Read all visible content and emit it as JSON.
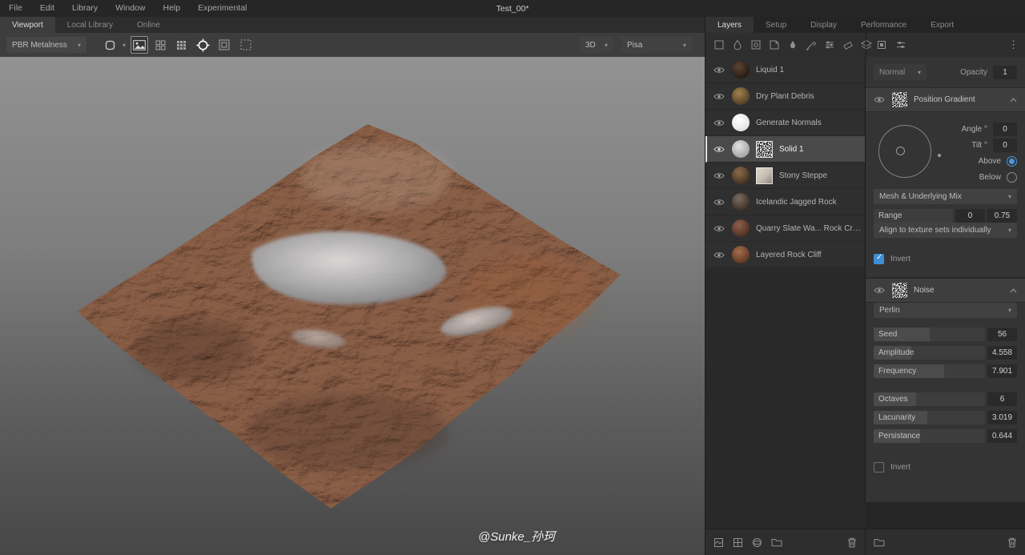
{
  "menubar": {
    "items": [
      "File",
      "Edit",
      "Library",
      "Window",
      "Help",
      "Experimental"
    ],
    "title": "Test_00*"
  },
  "left_tabs": [
    {
      "label": "Viewport",
      "active": true
    },
    {
      "label": "Local Library",
      "active": false
    },
    {
      "label": "Online",
      "active": false
    }
  ],
  "right_tabs": [
    {
      "label": "Layers",
      "active": true
    },
    {
      "label": "Setup",
      "active": false
    },
    {
      "label": "Display",
      "active": false
    },
    {
      "label": "Performance",
      "active": false
    },
    {
      "label": "Export",
      "active": false
    }
  ],
  "toolbar": {
    "shading_mode": "PBR Metalness",
    "view_mode": "3D",
    "model": "Pisa"
  },
  "viewport": {
    "watermark": "@Sunke_孙珂"
  },
  "layers": [
    {
      "name": "Liquid 1",
      "thumb": "liquid",
      "selected": false
    },
    {
      "name": "Dry Plant Debris",
      "thumb": "debris",
      "selected": false
    },
    {
      "name": "Generate Normals",
      "thumb": "white",
      "selected": false
    },
    {
      "name": "Solid 1",
      "thumb": "solid",
      "mask": "noise",
      "selected": true
    },
    {
      "name": "Stony Steppe",
      "thumb": "steppe",
      "mask": "light",
      "selected": false
    },
    {
      "name": "Icelandic Jagged Rock",
      "thumb": "icelandic",
      "selected": false
    },
    {
      "name": "Quarry Slate Wa... Rock Cracked",
      "thumb": "quarry",
      "selected": false
    },
    {
      "name": "Layered Rock Cliff",
      "thumb": "cliff",
      "selected": false
    }
  ],
  "properties": {
    "blend_mode": "Normal",
    "opacity_label": "Opacity",
    "opacity_value": "1",
    "position_gradient": {
      "title": "Position Gradient",
      "angle_label": "Angle °",
      "angle_value": "0",
      "tilt_label": "Tilt °",
      "tilt_value": "0",
      "above_label": "Above",
      "below_label": "Below",
      "mix_dropdown": "Mesh & Underlying Mix",
      "range_label": "Range",
      "range_min": "0",
      "range_max": "0.75",
      "align_dropdown": "Align to texture sets individually",
      "invert_label": "Invert",
      "invert_checked": true
    },
    "noise": {
      "title": "Noise",
      "type_dropdown": "Perlin",
      "fields": [
        {
          "label": "Seed",
          "value": "56",
          "fill": 0.5,
          "group": 1
        },
        {
          "label": "Amplitude",
          "value": "4.558",
          "fill": 0.34,
          "group": 1
        },
        {
          "label": "Frequency",
          "value": "7.901",
          "fill": 0.63,
          "group": 1
        },
        {
          "label": "Octaves",
          "value": "6",
          "fill": 0.38,
          "group": 2
        },
        {
          "label": "Lacunarity",
          "value": "3.019",
          "fill": 0.48,
          "group": 2
        },
        {
          "label": "Persistance",
          "value": "0.644",
          "fill": 0.42,
          "group": 2
        }
      ],
      "invert_label": "Invert",
      "invert_checked": false
    }
  },
  "colors": {
    "accent": "#3f8fd6",
    "selection": "#4a4a4a",
    "viewport_top": "#929292",
    "viewport_bottom": "#474747"
  }
}
